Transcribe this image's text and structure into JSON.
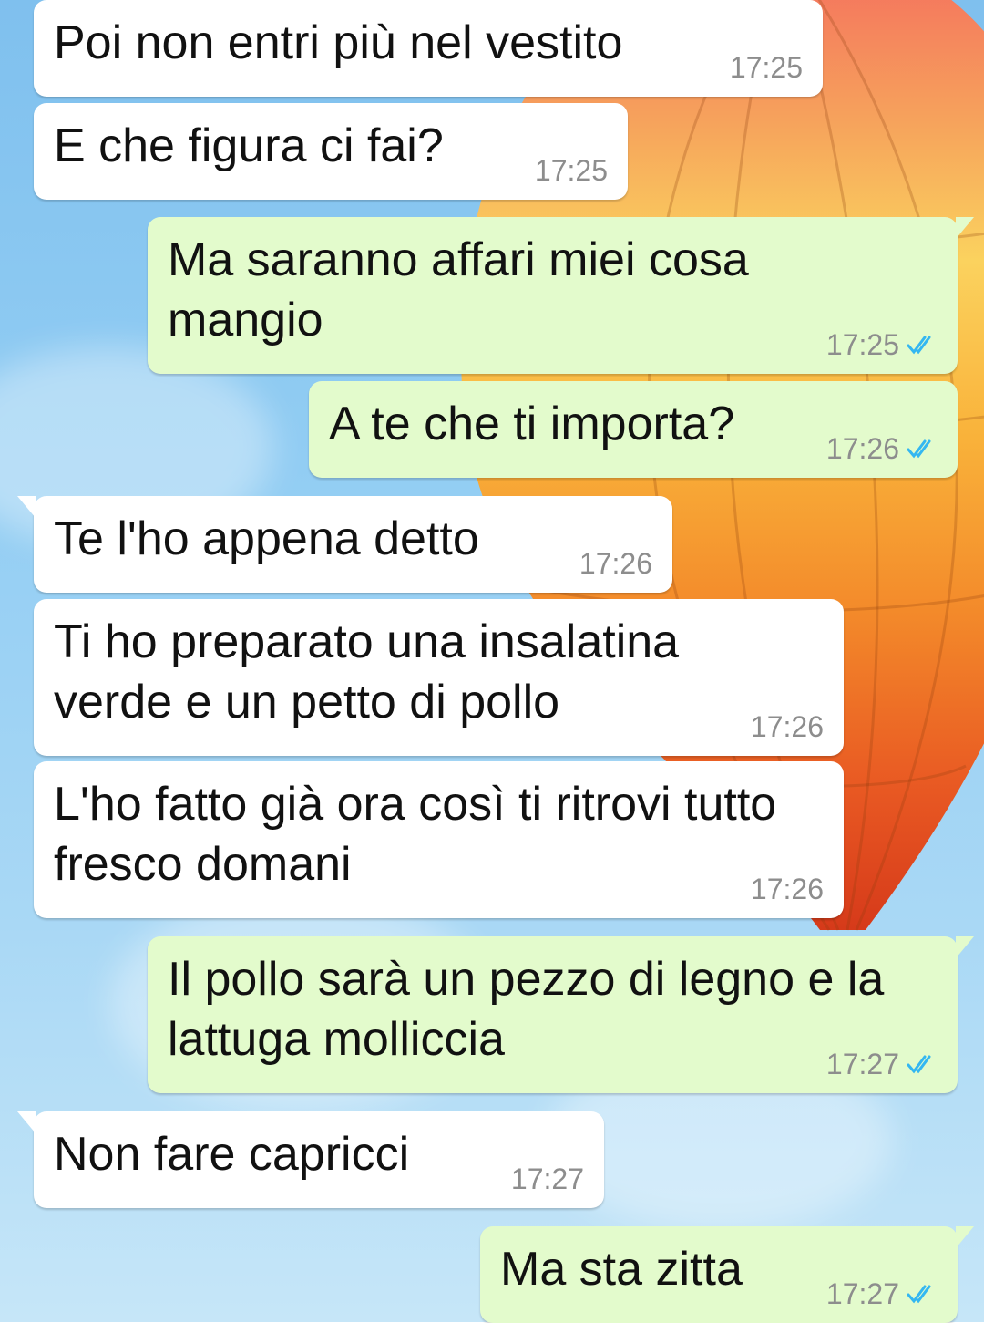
{
  "colors": {
    "incoming_bubble": "#ffffff",
    "outgoing_bubble": "#e3fbcc",
    "time_text": "#8d8d8d",
    "read_ticks": "#34b7f1"
  },
  "messages": [
    {
      "direction": "incoming",
      "text": "Poi non entri più nel vestito",
      "time": "17:25"
    },
    {
      "direction": "incoming",
      "text": "E che figura ci fai?",
      "time": "17:25"
    },
    {
      "direction": "outgoing",
      "text": "Ma saranno affari miei cosa\nmangio",
      "time": "17:25",
      "status": "read"
    },
    {
      "direction": "outgoing",
      "text": "A te che ti importa?",
      "time": "17:26",
      "status": "read"
    },
    {
      "direction": "incoming",
      "text": "Te l'ho appena detto",
      "time": "17:26"
    },
    {
      "direction": "incoming",
      "text": "Ti ho preparato una insalatina\nverde e un petto di pollo",
      "time": "17:26"
    },
    {
      "direction": "incoming",
      "text": "L'ho fatto già ora così ti ritrovi tutto\nfresco domani",
      "time": "17:26"
    },
    {
      "direction": "outgoing",
      "text": "Il pollo sarà un pezzo di legno e la\nlattuga molliccia",
      "time": "17:27",
      "status": "read"
    },
    {
      "direction": "incoming",
      "text": "Non fare capricci",
      "time": "17:27"
    },
    {
      "direction": "outgoing",
      "text": "Ma sta zitta",
      "time": "17:27",
      "status": "read"
    }
  ]
}
